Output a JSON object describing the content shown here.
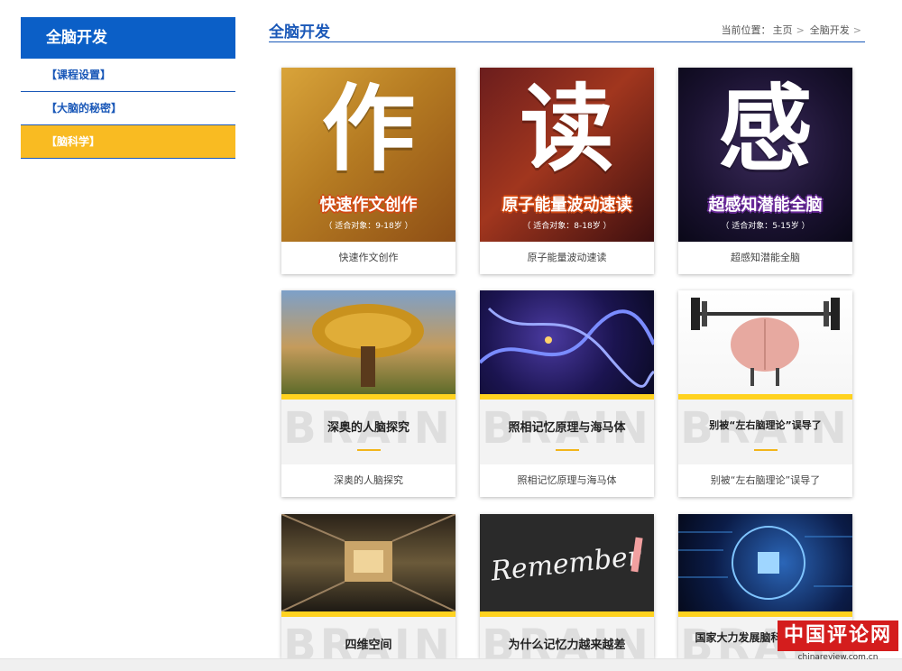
{
  "sidebar": {
    "title": "全脑开发",
    "items": [
      {
        "label": "【课程设置】"
      },
      {
        "label": "【大脑的秘密】"
      },
      {
        "label": "【脑科学】"
      }
    ]
  },
  "header": {
    "title": "全脑开发",
    "breadcrumb_prefix": "当前位置：",
    "breadcrumb": [
      "主页",
      "全脑开发"
    ],
    "separator": ">"
  },
  "posters": [
    {
      "char": "作",
      "title": "快速作文创作",
      "age": "（ 适合对象：9-18岁 ）",
      "caption": "快速作文创作"
    },
    {
      "char": "读",
      "title": "原子能量波动速读",
      "age": "（ 适合对象：8-18岁 ）",
      "caption": "原子能量波动速读"
    },
    {
      "char": "感",
      "title": "超感知潜能全脑",
      "age": "（ 适合对象：5-15岁 ）",
      "caption": "超感知潜能全脑"
    }
  ],
  "brain_cards": [
    {
      "watermark": "BRAIN",
      "title": "深奥的人脑探究",
      "caption": "深奥的人脑探究"
    },
    {
      "watermark": "BRAIN",
      "title": "照相记忆原理与海马体",
      "caption": "照相记忆原理与海马体"
    },
    {
      "watermark": "BRAIN",
      "title": "别被“左右脑理论”误导了",
      "caption": "别被“左右脑理论”误导了"
    },
    {
      "watermark": "BRAIN",
      "title": "四维空间"
    },
    {
      "watermark": "BRAIN",
      "title": "为什么记忆力越来越差"
    },
    {
      "watermark": "BRAIN",
      "title": "国家大力发展脑科学相关行业"
    }
  ],
  "remember_text": "Remember",
  "logo": {
    "text": "中国评论网",
    "url": "chinareview.com.cn"
  }
}
